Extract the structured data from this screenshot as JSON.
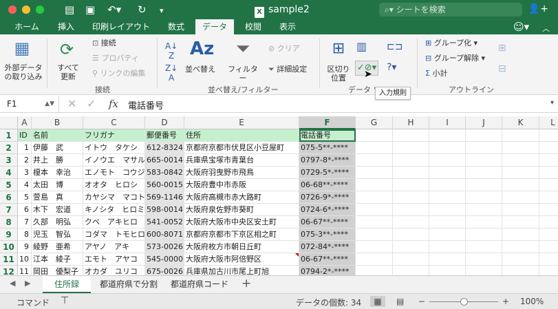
{
  "window": {
    "title": "sample2",
    "search_placeholder": "シートを検索"
  },
  "tabs": [
    {
      "label": "ホーム"
    },
    {
      "label": "挿入"
    },
    {
      "label": "印刷レイアウト"
    },
    {
      "label": "数式"
    },
    {
      "label": "データ",
      "active": true
    },
    {
      "label": "校閲"
    },
    {
      "label": "表示"
    }
  ],
  "ribbon": {
    "external_data": "外部データ\nの取り込み",
    "refresh_all": "すべて\n更新",
    "connections": "接続",
    "properties": "プロパティ",
    "edit_links": "リンクの編集",
    "group_connections": "接続",
    "sort": "並べ替え",
    "filter": "フィルター",
    "clear": "クリア",
    "advanced": "詳細設定",
    "group_sort_filter": "並べ替え/フィルター",
    "text_to_columns": "区切り\n位置",
    "group_data_tools": "データ ツ",
    "group": "グループ化",
    "ungroup": "グループ解除",
    "subtotal": "小計",
    "group_outline": "アウトライン",
    "tooltip": "入力規則"
  },
  "formula_bar": {
    "name_box": "F1",
    "fx": "fx",
    "content": "電話番号"
  },
  "grid": {
    "columns": [
      "A",
      "B",
      "C",
      "D",
      "E",
      "F",
      "G",
      "H",
      "I",
      "J",
      "K",
      "L"
    ],
    "selected_column": "F",
    "rows": [
      {
        "n": "1",
        "cells": [
          "ID",
          "名前",
          "フリガナ",
          "郵便番号",
          "住所",
          "電話番号"
        ]
      },
      {
        "n": "2",
        "cells": [
          "1",
          "伊藤　武",
          "イトウ　タケシ",
          "612-8324",
          "京都府京都市伏見区小豆屋町",
          "075-5**-****"
        ]
      },
      {
        "n": "3",
        "cells": [
          "2",
          "井上　勝",
          "イノウエ　マサル",
          "665-0014",
          "兵庫県宝塚市青葉台",
          "0797-8*-****"
        ]
      },
      {
        "n": "4",
        "cells": [
          "3",
          "榎本　幸治",
          "エノモト　コウジ",
          "583-0842",
          "大阪府羽曳野市飛鳥",
          "0729-5*-****"
        ]
      },
      {
        "n": "5",
        "cells": [
          "4",
          "太田　博",
          "オオタ　ヒロシ",
          "560-0015",
          "大阪府豊中市赤阪",
          "06-68**-****"
        ]
      },
      {
        "n": "6",
        "cells": [
          "5",
          "萱島　真",
          "カヤシマ　マコト",
          "569-1146",
          "大阪府高槻市赤大路町",
          "0726-9*-****"
        ]
      },
      {
        "n": "7",
        "cells": [
          "6",
          "木下　宏道",
          "キノシタ　ヒロミチ",
          "598-0014",
          "大阪府泉佐野市葵町",
          "0724-6*-****"
        ]
      },
      {
        "n": "8",
        "cells": [
          "7",
          "久部　明弘",
          "クベ　アキヒロ",
          "541-0052",
          "大阪府大阪市中央区安土町",
          "06-67**-****"
        ]
      },
      {
        "n": "9",
        "cells": [
          "8",
          "児玉　智弘",
          "コダマ　トモヒロ",
          "600-8071",
          "京都府京都市下京区相之町",
          "075-3**-****"
        ]
      },
      {
        "n": "10",
        "cells": [
          "9",
          "綾野　亜希",
          "アヤノ　アキ",
          "573-0026",
          "大阪府枚方市朝日丘町",
          "072-84*-****"
        ]
      },
      {
        "n": "11",
        "cells": [
          "10",
          "江本　綾子",
          "エモト　アヤコ",
          "545-0000",
          "大阪府大阪市阿倍野区",
          "06-67**-****"
        ]
      },
      {
        "n": "12",
        "cells": [
          "11",
          "岡田　優梨子",
          "オカダ　ユリコ",
          "675-0026",
          "兵庫県加古川市尾上町旭",
          "0794-2*-****"
        ]
      }
    ]
  },
  "sheets": [
    {
      "label": "住所録",
      "active": true
    },
    {
      "label": "都道府県で分割"
    },
    {
      "label": "都道府県コード"
    }
  ],
  "status": {
    "mode": "コマンド",
    "count": "データの個数: 34",
    "zoom": "100%",
    "zoom_minus": "−",
    "zoom_plus": "+"
  },
  "colors": {
    "brand": "#217346",
    "header_fill": "#c6efce"
  }
}
